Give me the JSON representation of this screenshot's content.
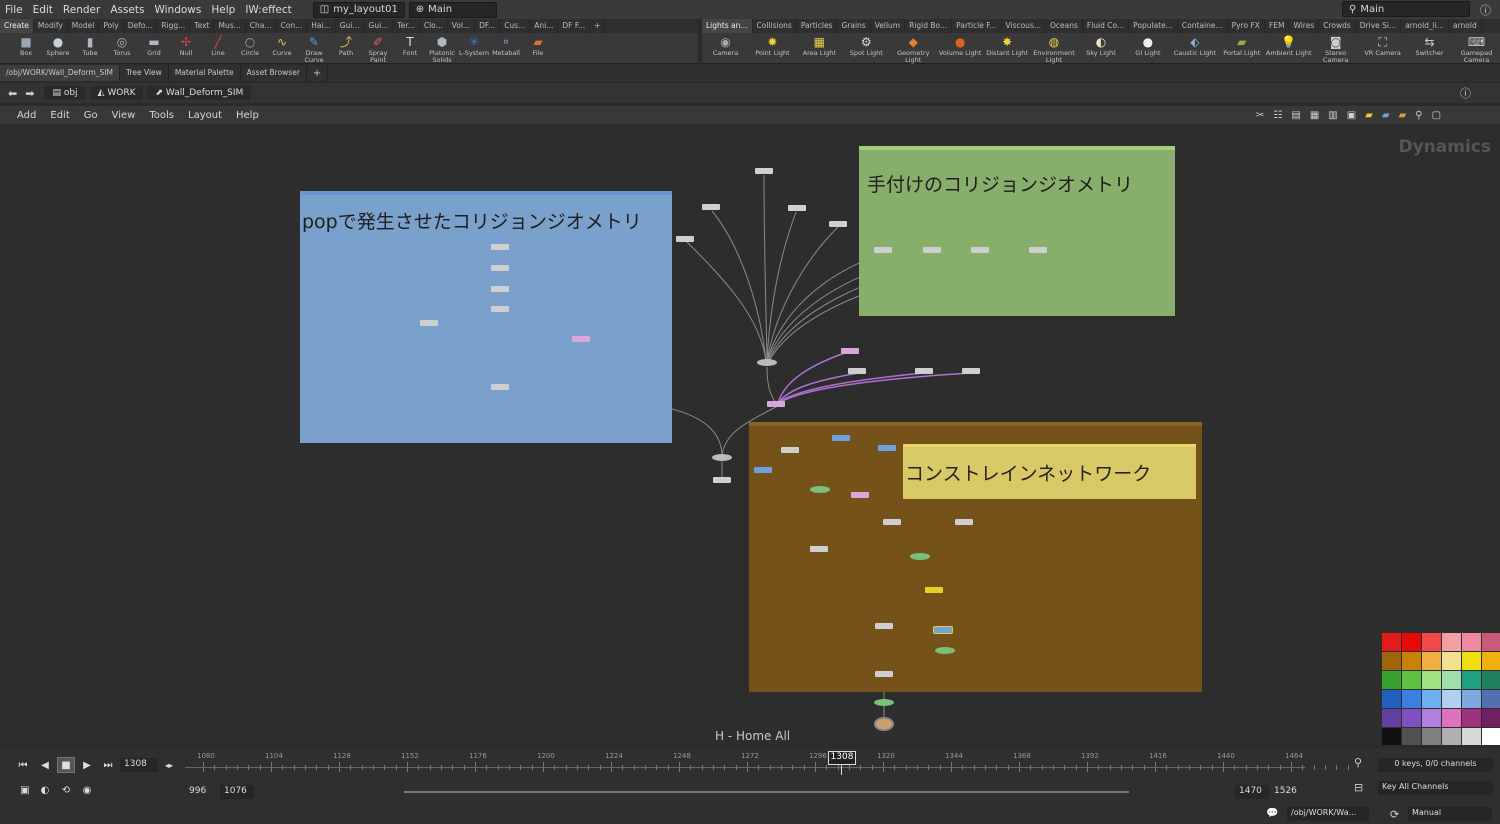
{
  "menu": [
    "File",
    "Edit",
    "Render",
    "Assets",
    "Windows",
    "Help",
    "IW:effect"
  ],
  "layout": "my_layout01",
  "desktop": "Main",
  "desktop_right": "Main",
  "shelf_left_tabs": [
    "Create",
    "Modify",
    "Model",
    "Poly",
    "Defo...",
    "Rigg...",
    "Text",
    "Mus...",
    "Cha...",
    "Con...",
    "Hai...",
    "Gui...",
    "Gui...",
    "Ter...",
    "Clo...",
    "Vol...",
    "DF...",
    "Cus...",
    "Ani...",
    "DF F..."
  ],
  "shelf_left_tools": [
    {
      "label": "Box",
      "icon": "box-icon",
      "g": "■",
      "c": "#9aa6b4"
    },
    {
      "label": "Sphere",
      "icon": "sphere-icon",
      "g": "●",
      "c": "#c9d1da"
    },
    {
      "label": "Tube",
      "icon": "tube-icon",
      "g": "▮",
      "c": "#aeb8c4"
    },
    {
      "label": "Torus",
      "icon": "torus-icon",
      "g": "◎",
      "c": "#aeb8c4"
    },
    {
      "label": "Grid",
      "icon": "grid-icon",
      "g": "▬",
      "c": "#aeb8c4"
    },
    {
      "label": "Null",
      "icon": "null-icon",
      "g": "✢",
      "c": "#d44"
    },
    {
      "label": "Line",
      "icon": "line-icon",
      "g": "╱",
      "c": "#d44"
    },
    {
      "label": "Circle",
      "icon": "circle-icon",
      "g": "○",
      "c": "#aaa"
    },
    {
      "label": "Curve",
      "icon": "curve-icon",
      "g": "∿",
      "c": "#e0c050"
    },
    {
      "label": "Draw Curve",
      "icon": "draw-curve-icon",
      "g": "✎",
      "c": "#4aa0e0"
    },
    {
      "label": "Path",
      "icon": "path-icon",
      "g": "⤴",
      "c": "#e0c050"
    },
    {
      "label": "Spray Paint",
      "icon": "spray-paint-icon",
      "g": "✐",
      "c": "#e06060"
    },
    {
      "label": "Font",
      "icon": "font-icon",
      "g": "T",
      "c": "#ddd"
    },
    {
      "label": "Platonic Solids",
      "icon": "platonic-solids-icon",
      "g": "⬢",
      "c": "#aeb8c4"
    },
    {
      "label": "L-System",
      "icon": "l-system-icon",
      "g": "✳",
      "c": "#3a7ad0"
    },
    {
      "label": "Metaball",
      "icon": "metaball-icon",
      "g": "⚬",
      "c": "#6aa0e0"
    },
    {
      "label": "File",
      "icon": "file-icon",
      "g": "▰",
      "c": "#e07030"
    }
  ],
  "shelf_right_tabs": [
    "Lights an...",
    "Collisions",
    "Particles",
    "Grains",
    "Vellum",
    "Rigid Bo...",
    "Particle F...",
    "Viscous...",
    "Oceans",
    "Fluid Co...",
    "Populate...",
    "Containe...",
    "Pyro FX",
    "FEM",
    "Wires",
    "Crowds",
    "Drive Si...",
    "arnold_li...",
    "arnold"
  ],
  "shelf_right_tools": [
    {
      "label": "Camera",
      "icon": "camera-icon",
      "g": "◉",
      "c": "#aaa"
    },
    {
      "label": "Point Light",
      "icon": "point-light-icon",
      "g": "✹",
      "c": "#f0d040"
    },
    {
      "label": "Area Light",
      "icon": "area-light-icon",
      "g": "▦",
      "c": "#f0d040"
    },
    {
      "label": "Spot Light",
      "icon": "spot-light-icon",
      "g": "⚙",
      "c": "#ddd"
    },
    {
      "label": "Geometry Light",
      "icon": "geometry-light-icon",
      "g": "◆",
      "c": "#e08030"
    },
    {
      "label": "Volume Light",
      "icon": "volume-light-icon",
      "g": "●",
      "c": "#e06020"
    },
    {
      "label": "Distant Light",
      "icon": "distant-light-icon",
      "g": "✸",
      "c": "#f0d040"
    },
    {
      "label": "Environment Light",
      "icon": "environment-light-icon",
      "g": "◍",
      "c": "#f0d040"
    },
    {
      "label": "Sky Light",
      "icon": "sky-light-icon",
      "g": "◐",
      "c": "#f0e0c0"
    },
    {
      "label": "GI Light",
      "icon": "gi-light-icon",
      "g": "●",
      "c": "#eee"
    },
    {
      "label": "Caustic Light",
      "icon": "caustic-light-icon",
      "g": "⬖",
      "c": "#8ab0e0"
    },
    {
      "label": "Portal Light",
      "icon": "portal-light-icon",
      "g": "▰",
      "c": "#90b040"
    },
    {
      "label": "Ambient Light",
      "icon": "ambient-light-icon",
      "g": "💡",
      "c": "#eee"
    },
    {
      "label": "Stereo Camera",
      "icon": "stereo-camera-icon",
      "g": "◙",
      "c": "#ccc"
    },
    {
      "label": "VR Camera",
      "icon": "vr-camera-icon",
      "g": "⛶",
      "c": "#ccc"
    },
    {
      "label": "Switcher",
      "icon": "switcher-icon",
      "g": "⇆",
      "c": "#ccc"
    },
    {
      "label": "Gamepad Camera",
      "icon": "gamepad-camera-icon",
      "g": "⌨",
      "c": "#ccc"
    }
  ],
  "pane_path": "/obj/WORK/Wall_Deform_SIM",
  "pane_tabs": [
    "Tree View",
    "Material Palette",
    "Asset Browser"
  ],
  "path": [
    "obj",
    "WORK",
    "Wall_Deform_SIM"
  ],
  "net_menu": [
    "Add",
    "Edit",
    "Go",
    "View",
    "Tools",
    "Layout",
    "Help"
  ],
  "context_label": "Dynamics",
  "boxes": {
    "blue": "popで発生させたコリジョンジオメトリ",
    "green": "手付けのコリジョンジオメトリ",
    "brown_note": "コンストレインネットワーク"
  },
  "home_hint": "H - Home All",
  "timeline": {
    "frame": "1308",
    "ticks": [
      "1080",
      "1104",
      "1128",
      "1152",
      "1176",
      "1200",
      "1224",
      "1248",
      "1272",
      "1296",
      "1320",
      "1344",
      "1368",
      "1392",
      "1416",
      "1440",
      "1464"
    ],
    "start": "996",
    "range_start": "1076",
    "range_end": "1470",
    "end": "1526",
    "keys": "0 keys, 0/0 channels",
    "key_all": "Key All Channels"
  },
  "status": {
    "path": "/obj/WORK/Wa...",
    "mode": "Manual"
  },
  "palette": [
    "#e41b1b",
    "#e60a0a",
    "#f04a4a",
    "#f5a0a0",
    "#f08aa0",
    "#c85a7a",
    "#a0640a",
    "#c8820a",
    "#f0b040",
    "#f5e090",
    "#f0e010",
    "#f0b010",
    "#3aa030",
    "#60c040",
    "#a0e080",
    "#a0e0b0",
    "#20a080",
    "#208060",
    "#2060c0",
    "#3a80e0",
    "#70b0f0",
    "#b0d0f0",
    "#80a8e0",
    "#5070b0",
    "#6040a0",
    "#8050c0",
    "#b080e0",
    "#e070c0",
    "#a03080",
    "#702060",
    "#101010",
    "#505050",
    "#808080",
    "#b0b0b0",
    "#d8d8d8",
    "#ffffff"
  ]
}
